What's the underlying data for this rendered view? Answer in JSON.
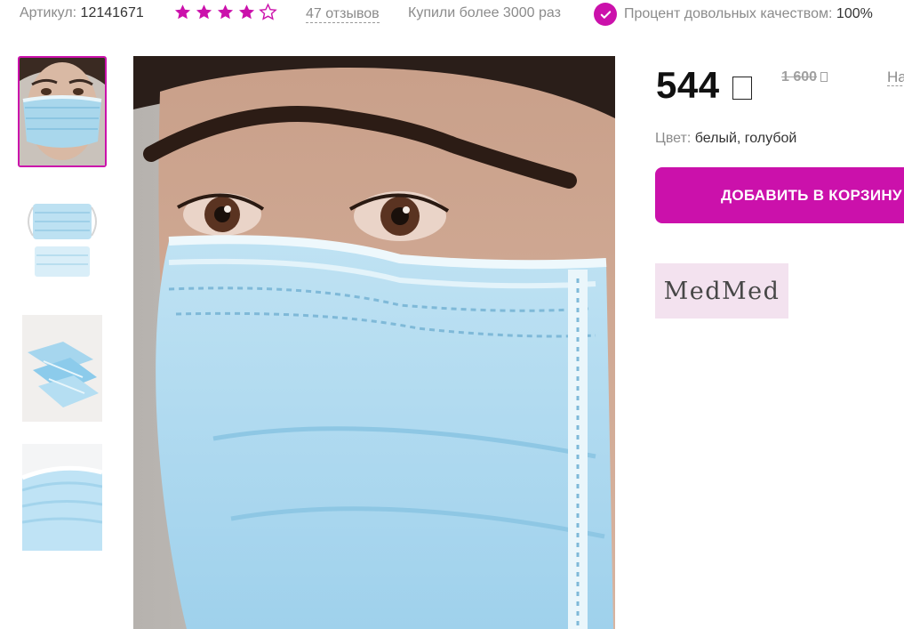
{
  "topbar": {
    "article_label": "Артикул:",
    "article_value": "12141671",
    "rating": 4,
    "rating_max": 5,
    "reviews": "47 отзывов",
    "bought": "Купили более 3000 раз",
    "quality_label": "Процент довольных качеством:",
    "quality_value": "100%"
  },
  "gallery": {
    "thumbnails": [
      "face-mask-model",
      "two-masks-flat",
      "mask-stack",
      "mask-closeup"
    ],
    "active_index": 0,
    "main_image": "woman-wearing-blue-surgical-mask"
  },
  "product": {
    "price": "544",
    "old_price": "1 600",
    "na_link": "На",
    "color_label": "Цвет:",
    "color_value": "белый, голубой",
    "add_to_cart": "ДОБАВИТЬ В КОРЗИНУ",
    "brand": "MedMed"
  },
  "colors": {
    "accent": "#cb11ab",
    "brand_bg": "#f3e2ef"
  }
}
